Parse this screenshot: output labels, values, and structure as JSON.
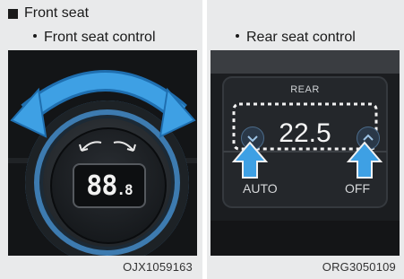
{
  "left_panel": {
    "section_title": "Front seat",
    "subtitle": "Front seat control",
    "display_value": "88",
    "display_small": ".8",
    "photo_code": "OJX1059163"
  },
  "right_panel": {
    "subtitle": "Rear seat control",
    "rear_label": "REAR",
    "temperature": "22.5",
    "auto_label": "AUTO",
    "off_label": "OFF",
    "photo_code": "ORG3050109"
  },
  "colors": {
    "arrow_blue": "#2a8fd6",
    "panel_bg": "#e9eaeb"
  }
}
